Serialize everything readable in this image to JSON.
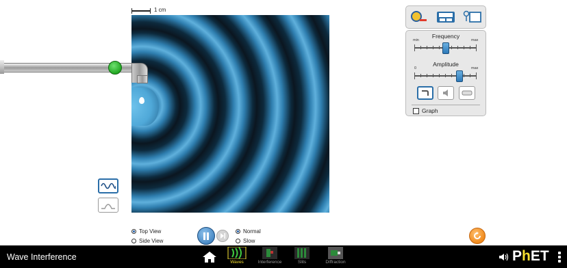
{
  "app": {
    "title": "Wave Interference"
  },
  "scale": {
    "label": "1 cm"
  },
  "wave_types": [
    {
      "icon": "continuous-wave-icon",
      "selected": true
    },
    {
      "icon": "pulse-wave-icon",
      "selected": false
    }
  ],
  "toolbox": {
    "items": [
      "measuring-tape-icon",
      "stopwatch-icon",
      "wave-detector-icon"
    ]
  },
  "controls": {
    "frequency": {
      "label": "Frequency",
      "min_label": "min",
      "max_label": "max",
      "value": 0.5
    },
    "amplitude": {
      "label": "Amplitude",
      "min_label": "0",
      "max_label": "max",
      "value": 0.72
    },
    "graph_label": "Graph",
    "graph_checked": false,
    "scene_buttons": [
      "water-faucet-icon",
      "sound-speaker-icon",
      "light-laser-icon"
    ]
  },
  "view": {
    "top_view": "Top View",
    "side_view": "Side View",
    "selected": "top"
  },
  "speed": {
    "normal": "Normal",
    "slow": "Slow",
    "selected": "normal"
  },
  "nav": {
    "screens": [
      {
        "label": "Waves",
        "active": true
      },
      {
        "label": "Interference",
        "active": false
      },
      {
        "label": "Slits",
        "active": false
      },
      {
        "label": "Diffraction",
        "active": false
      }
    ],
    "brand": "PhET"
  },
  "colors": {
    "accent": "#2a6ea8",
    "active_tab": "#f5df2f",
    "wave": "#5fb0dc",
    "knob": "#23a823",
    "reset": "#f08a1c"
  }
}
